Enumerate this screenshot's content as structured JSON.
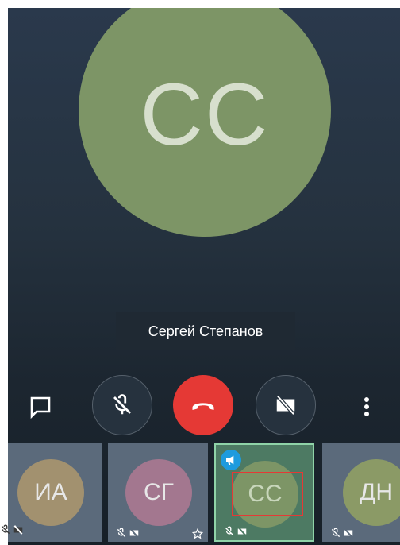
{
  "main": {
    "initials": "СС",
    "name": "Сергей Степанов"
  },
  "controls": {
    "chat": "chat-icon",
    "mute": "mic-off-icon",
    "hangup": "hang-up-icon",
    "video": "video-off-icon",
    "more": "more-vertical-icon"
  },
  "participants": [
    {
      "initials": "ИА",
      "color": "#a2916f",
      "muted": true,
      "video_off": true
    },
    {
      "initials": "СГ",
      "color": "#a3778f",
      "muted": true,
      "video_off": true,
      "starred": true
    },
    {
      "initials": "СС",
      "color": "#7d9566",
      "muted": true,
      "video_off": true,
      "active": true,
      "speaker": true
    },
    {
      "initials": "ДН",
      "color": "#8b9a66",
      "muted": true,
      "video_off": true
    }
  ],
  "colors": {
    "hangup": "#e53935",
    "active_border": "#8fd3a8",
    "speaker_badge": "#1e9bde",
    "highlight": "#e53935"
  }
}
